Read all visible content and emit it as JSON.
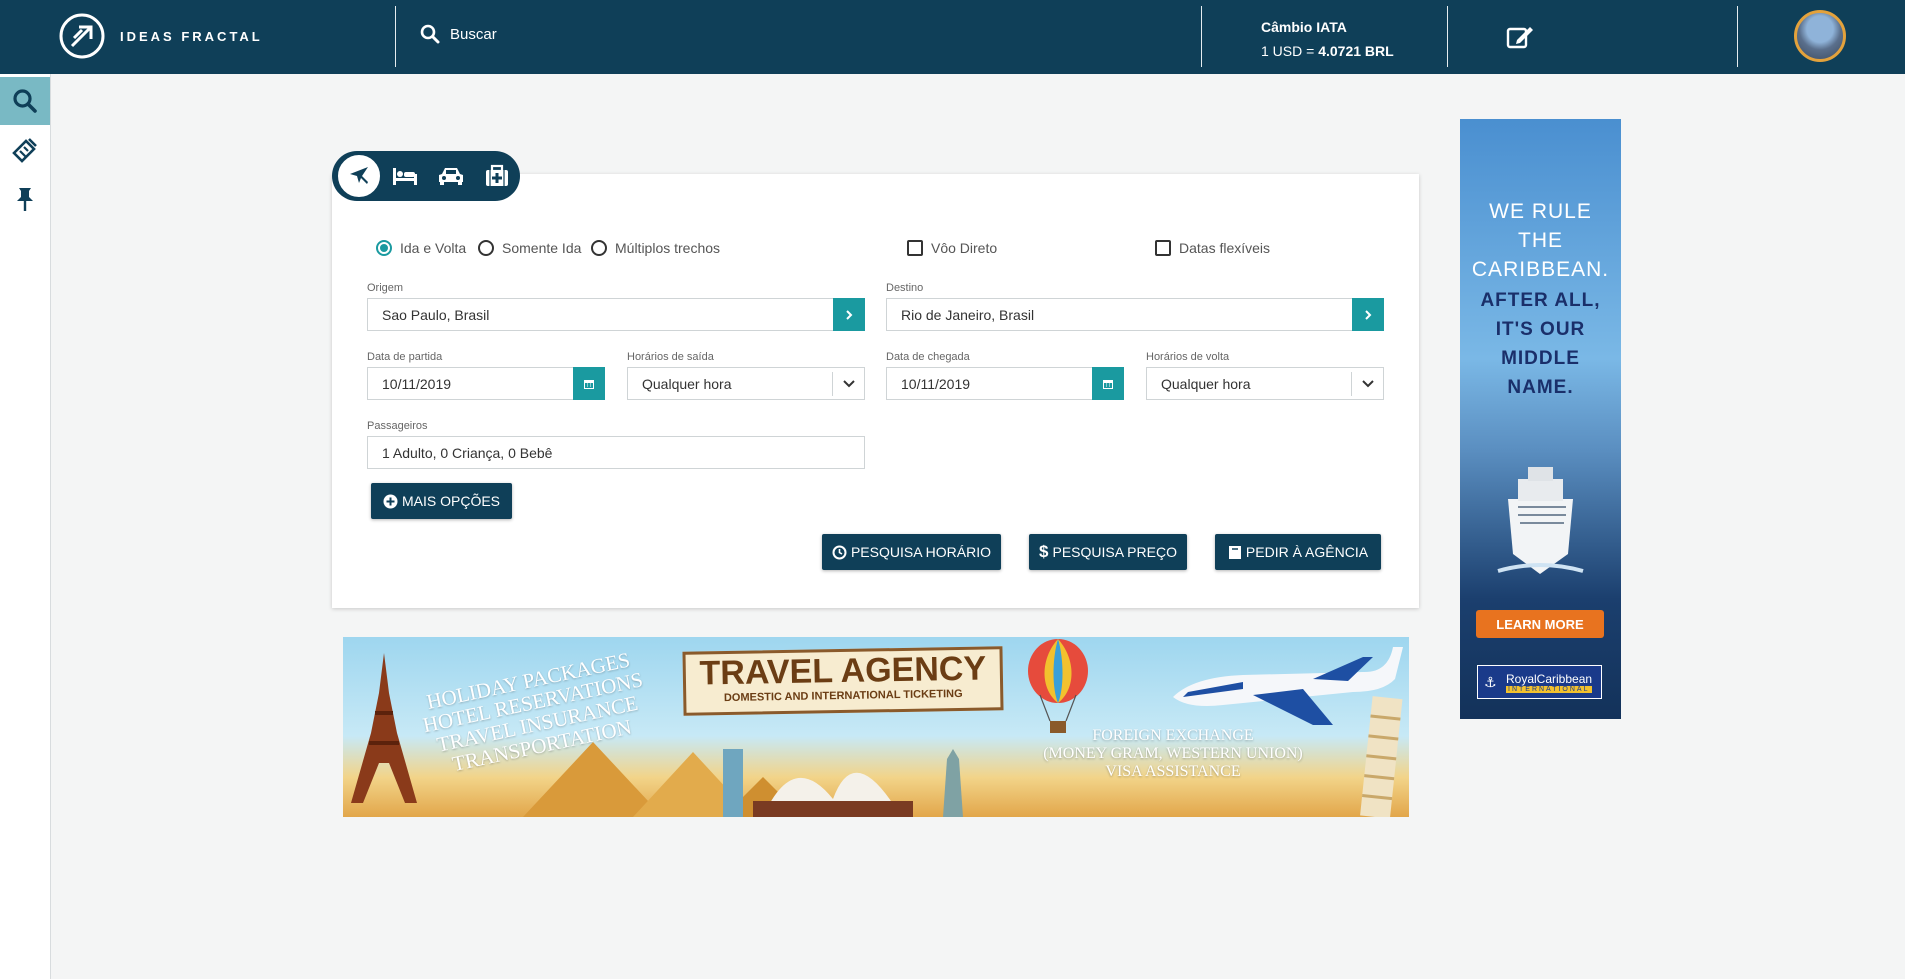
{
  "header": {
    "logo_text": "IDEAS FRACTAL",
    "search_label": "Buscar",
    "cambio_title": "Câmbio IATA",
    "cambio_prefix": "1 USD = ",
    "cambio_value": "4.0721 BRL"
  },
  "sidebar": {
    "items": [
      {
        "icon": "search-icon",
        "active": true
      },
      {
        "icon": "ticket-icon",
        "active": false
      },
      {
        "icon": "pin-icon",
        "active": false
      }
    ]
  },
  "tabs": [
    {
      "icon": "plane-icon",
      "active": true
    },
    {
      "icon": "bed-icon",
      "active": false
    },
    {
      "icon": "car-icon",
      "active": false
    },
    {
      "icon": "medkit-icon",
      "active": false
    }
  ],
  "trip_type": {
    "options": [
      "Ida e Volta",
      "Somente Ida",
      "Múltiplos trechos"
    ],
    "selected": "Ida e Volta"
  },
  "filters": {
    "direct_flight": "Vôo Direto",
    "flexible_dates": "Datas flexíveis"
  },
  "form": {
    "origin_label": "Origem",
    "origin_value": "Sao Paulo, Brasil",
    "destination_label": "Destino",
    "destination_value": "Rio de Janeiro, Brasil",
    "departure_date_label": "Data de partida",
    "departure_date_value": "10/11/2019",
    "departure_time_label": "Horários de saída",
    "departure_time_value": "Qualquer hora",
    "arrival_date_label": "Data de chegada",
    "arrival_date_value": "10/11/2019",
    "return_time_label": "Horários de volta",
    "return_time_value": "Qualquer hora",
    "passengers_label": "Passageiros",
    "passengers_value": "1 Adulto, 0 Criança, 0 Bebê"
  },
  "buttons": {
    "more_options": "MAIS OPÇÕES",
    "search_schedule": "PESQUISA HORÁRIO",
    "search_price": "PESQUISA PREÇO",
    "ask_agency": "PEDIR À AGÊNCIA"
  },
  "banner": {
    "left_lines": [
      "HOLIDAY PACKAGES",
      "HOTEL RESERVATIONS",
      "TRAVEL INSURANCE",
      "TRANSPORTATION"
    ],
    "title": "TRAVEL AGENCY",
    "subtitle": "DOMESTIC AND INTERNATIONAL TICKETING",
    "right_lines": [
      "FOREIGN EXCHANGE",
      "(MONEY GRAM, WESTERN UNION)",
      "VISA ASSISTANCE"
    ]
  },
  "side_ad": {
    "line1": "WE RULE",
    "line2": "THE",
    "line3": "CARIBBEAN.",
    "line4": "AFTER ALL,",
    "line5": "IT'S OUR",
    "line6": "MIDDLE",
    "line7": "NAME.",
    "cta": "LEARN MORE",
    "brand": "RoyalCaribbean",
    "brand_sub": "INTERNATIONAL"
  },
  "colors": {
    "navy": "#0f3f58",
    "teal": "#1a9aa0",
    "sidebar_active": "#79b9c4"
  }
}
